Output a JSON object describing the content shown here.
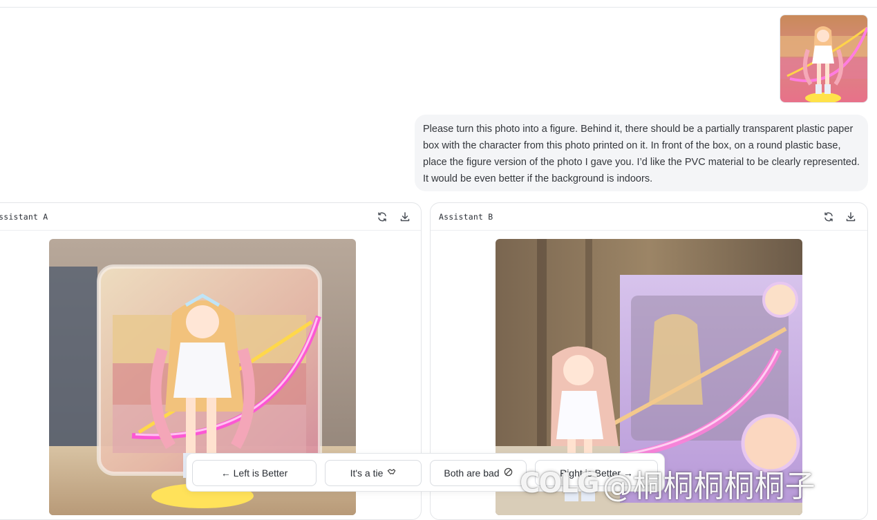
{
  "conversation": {
    "user_message": "Please turn this photo into a figure. Behind it, there should be a partially transparent plastic paper box with the character from this photo printed on it. In front of the box, on a round plastic base, place the figure version of the photo I gave you. I’d like the PVC material to be clearly represented. It would be even better if the background is indoors."
  },
  "panels": {
    "left": {
      "title": "Assistant A",
      "refresh_icon": "refresh-icon",
      "download_icon": "download-icon"
    },
    "right": {
      "title": "Assistant B",
      "refresh_icon": "refresh-icon",
      "download_icon": "download-icon"
    }
  },
  "vote_bar": {
    "left_better": "← Left is Better",
    "tie": "It's a tie",
    "both_bad": "Both are bad",
    "right_better": "Right is Better →"
  },
  "watermark": {
    "logo": "COLG",
    "text": "@桐桐桐桐桐子"
  },
  "colors": {
    "bubble_bg": "#f4f5f7",
    "border": "#e3e5e8",
    "accent_pink": "#ff4fd8",
    "box_purple": "#c9b3e6"
  }
}
